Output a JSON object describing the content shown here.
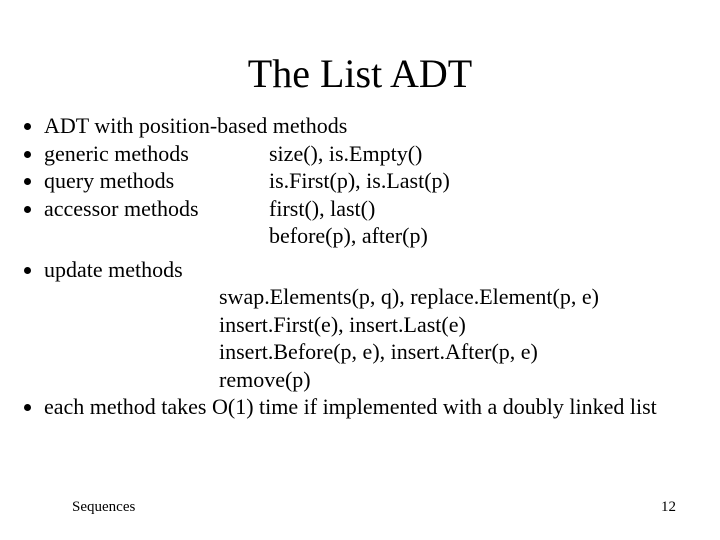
{
  "title": "The List ADT",
  "bullets_top": {
    "b1": "ADT with position-based methods",
    "b2_label": "generic methods",
    "b2_val": "size(), is.Empty()",
    "b3_label": "query methods",
    "b3_val": "is.First(p), is.Last(p)",
    "b4_label": "accessor methods",
    "b4_val": "first(), last()",
    "b4_val2": "before(p), after(p)"
  },
  "bullets_bot": {
    "b5": "update methods",
    "u1": "swap.Elements(p, q), replace.Element(p, e)",
    "u2": "insert.First(e), insert.Last(e)",
    "u3": "insert.Before(p, e), insert.After(p, e)",
    "u4": "remove(p)",
    "b6": "each method takes O(1) time if implemented with a doubly linked list"
  },
  "footer": {
    "left": "Sequences",
    "right": "12"
  }
}
